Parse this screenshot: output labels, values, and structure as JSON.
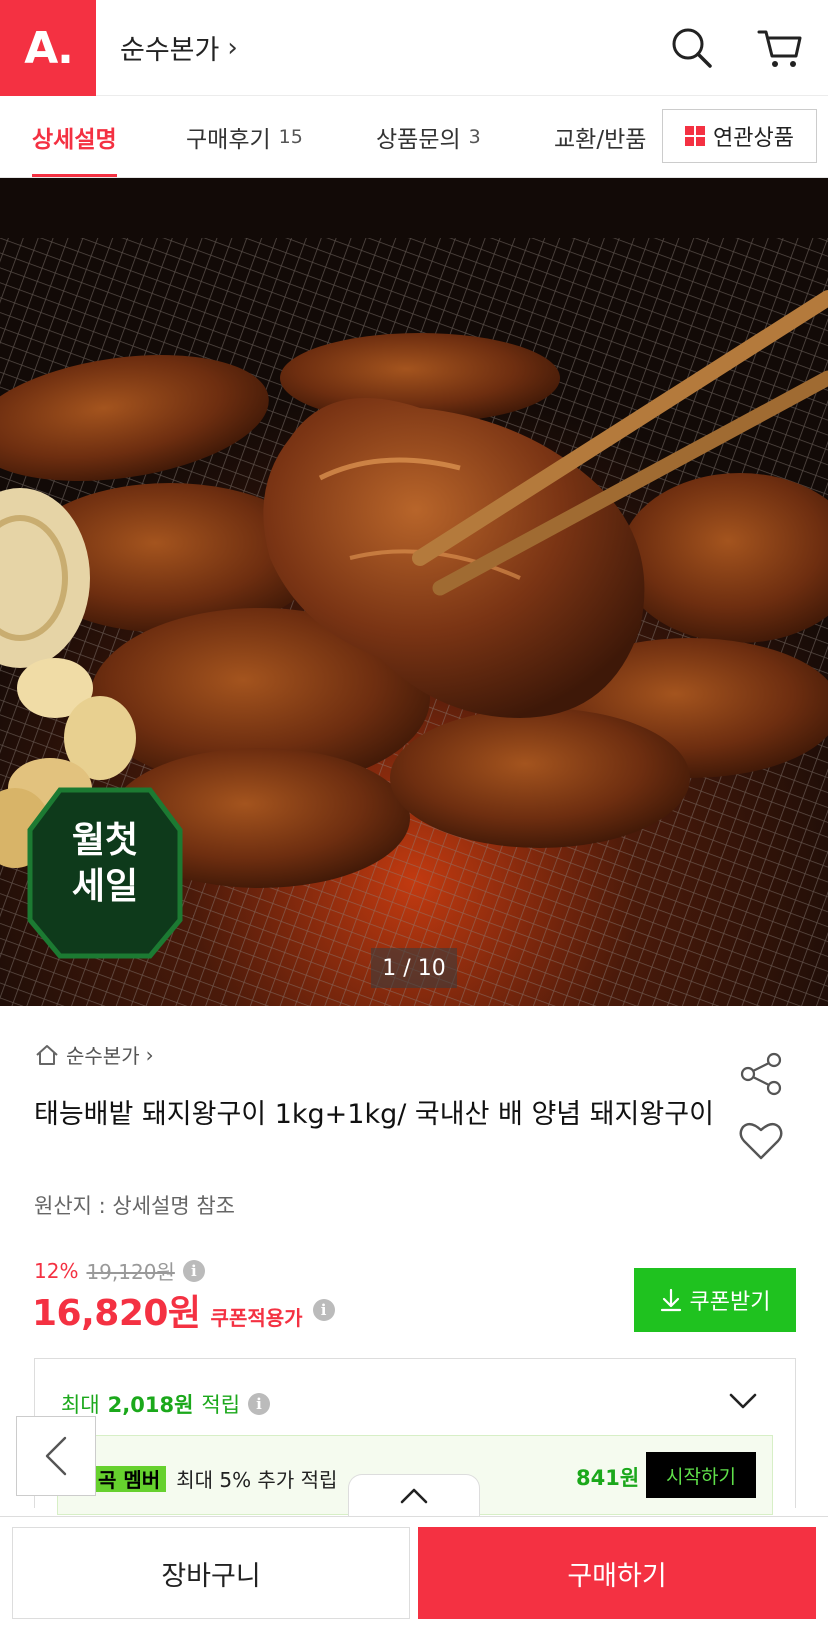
{
  "header": {
    "logo_text": "A.",
    "store_name": "순수본가",
    "store_chevron": "›",
    "brand_color": "#f43142"
  },
  "tabs": [
    {
      "label": "상세설명",
      "count": "",
      "active": true
    },
    {
      "label": "구매후기",
      "count": "15",
      "active": false
    },
    {
      "label": "상품문의",
      "count": "3",
      "active": false
    },
    {
      "label": "교환/반품",
      "count": "",
      "active": false
    }
  ],
  "related_button": {
    "label": "연관상품"
  },
  "hero": {
    "image_counter": "1 / 10",
    "badge_line1": "월첫",
    "badge_line2": "세일"
  },
  "product": {
    "shop_name": "순수본가",
    "shop_chevron": "›",
    "title": "태능배밭 돼지왕구이 1kg+1kg/ 국내산 배 양념 돼지왕구이",
    "origin": "원산지 : 상세설명 참조",
    "discount_pct": "12%",
    "original_price": "19,120원",
    "price": "16,820원",
    "coupon_price_label": "쿠폰적용가",
    "coupon_button": "쿠폰받기",
    "info_mark": "i"
  },
  "points": {
    "prefix": "최대",
    "amount": "2,018원",
    "suffix": "적립",
    "member_badge": "멤버",
    "member_badge_prefix": "곡",
    "member_text": "최대 5% 추가 적립",
    "member_points": "841원",
    "start_button": "시작하기"
  },
  "bottom": {
    "cart_button": "장바구니",
    "buy_button": "구매하기"
  }
}
